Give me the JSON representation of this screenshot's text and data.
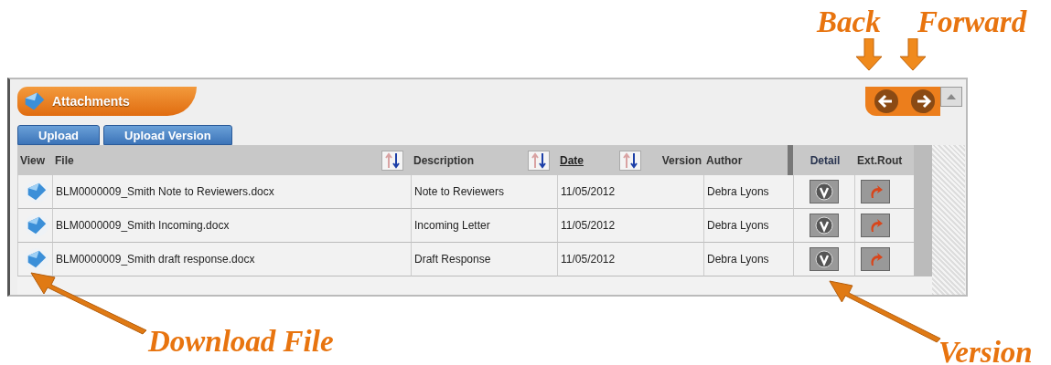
{
  "annotations": [
    {
      "label": "Back",
      "kind": "down"
    },
    {
      "label": "Forward",
      "kind": "down"
    },
    {
      "label": "Download File",
      "kind": "up-left"
    },
    {
      "label": "Version",
      "kind": "up-left"
    }
  ],
  "panel": {
    "title": "Attachments"
  },
  "buttons": [
    "Upload",
    "Upload Version"
  ],
  "columns": [
    {
      "label": "View",
      "kind": "plain"
    },
    {
      "label": "File",
      "kind": "plain"
    },
    {
      "label": "Description",
      "kind": "plain"
    },
    {
      "label": "Date",
      "kind": "link"
    },
    {
      "label": "Version",
      "kind": "plain"
    },
    {
      "label": "Author",
      "kind": "plain"
    },
    {
      "label": "Detail",
      "kind": "plain"
    },
    {
      "label": "Ext.Rout",
      "kind": "plain"
    }
  ],
  "rows": [
    {
      "file": "BLM0000009_Smith Note to Reviewers.docx",
      "description": "Note to Reviewers",
      "date": "11/05/2012",
      "author": "Debra Lyons"
    },
    {
      "file": "BLM0000009_Smith Incoming.docx",
      "description": "Incoming Letter",
      "date": "11/05/2012",
      "author": "Debra Lyons"
    },
    {
      "file": "BLM0000009_Smith draft response.docx",
      "description": "Draft Response",
      "date": "11/05/2012",
      "author": "Debra Lyons"
    }
  ]
}
